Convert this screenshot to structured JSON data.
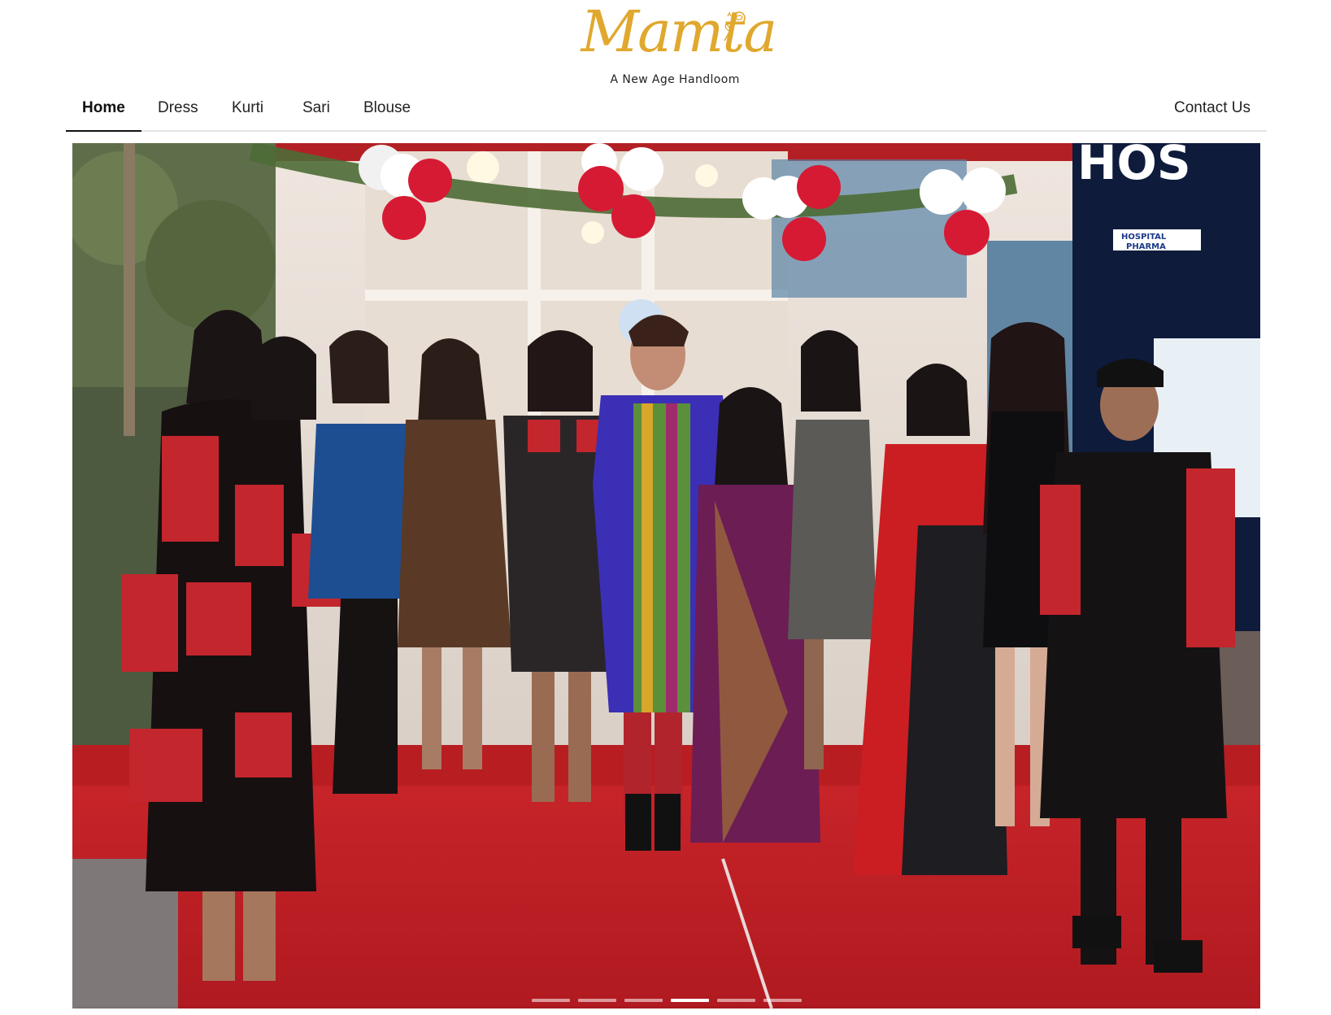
{
  "brand": {
    "logo_text": "Mamta",
    "tagline": "A New Age Handloom",
    "accent_color": "#e0a82e"
  },
  "nav": {
    "items": [
      {
        "label": "Home",
        "active": true
      },
      {
        "label": "Dress",
        "active": false
      },
      {
        "label": "Kurti",
        "active": false
      },
      {
        "label": "Sari",
        "active": false
      },
      {
        "label": "Blouse",
        "active": false
      }
    ],
    "contact": "Contact Us"
  },
  "hero": {
    "storefront_sign_top": "HOS",
    "storefront_sign_bottom_1": "HOSPITAL",
    "storefront_sign_bottom_2": "PHARMA",
    "slide_count": 6,
    "active_slide": 4
  }
}
